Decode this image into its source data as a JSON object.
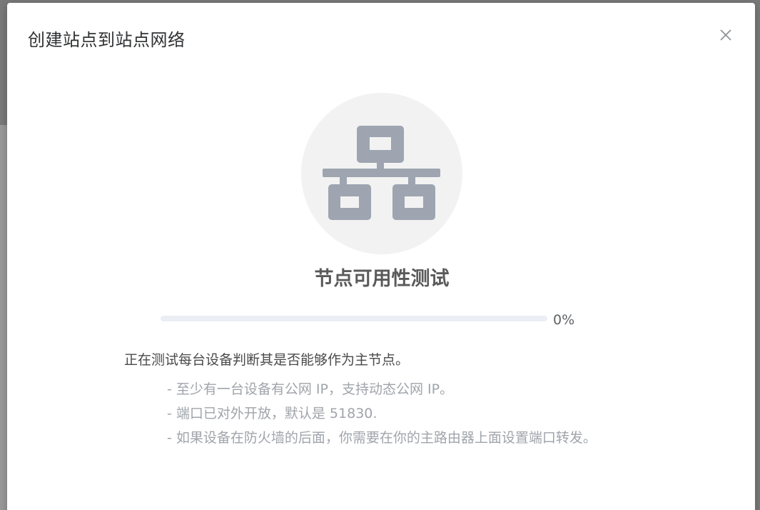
{
  "dialog": {
    "title": "创建站点到站点网络",
    "close_icon": "close-icon"
  },
  "test": {
    "icon": "network-nodes-icon",
    "title": "节点可用性测试",
    "progress_value": 0,
    "progress_text": "0%",
    "progress_color": "#409eff",
    "description": "正在测试每台设备判断其是否能够作为主节点。",
    "notes": [
      "- 至少有一台设备有公网 IP，支持动态公网 IP。",
      "- 端口已对外开放，默认是 51830.",
      "- 如果设备在防火墙的后面，你需要在你的主路由器上面设置端口转发。"
    ]
  },
  "colors": {
    "icon_gray": "#9ea5b0",
    "icon_bg": "#f2f2f2",
    "progress_track": "#ebeef5"
  }
}
